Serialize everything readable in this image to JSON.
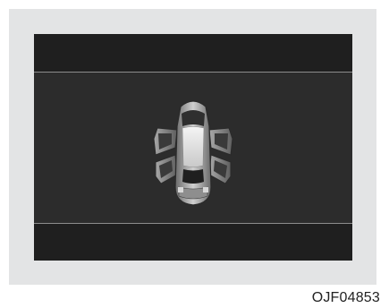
{
  "figure_code": "OJF04853",
  "display": {
    "top_band_text": "",
    "bottom_band_text": "",
    "icon": "car-doors-open-icon",
    "doors_open": [
      "front-left",
      "rear-left",
      "front-right",
      "rear-right"
    ]
  },
  "colors": {
    "panel": "#e3e4e5",
    "screen": "#2c2c2c",
    "band": "#1f1f1f",
    "divider": "#8d8d8d"
  }
}
